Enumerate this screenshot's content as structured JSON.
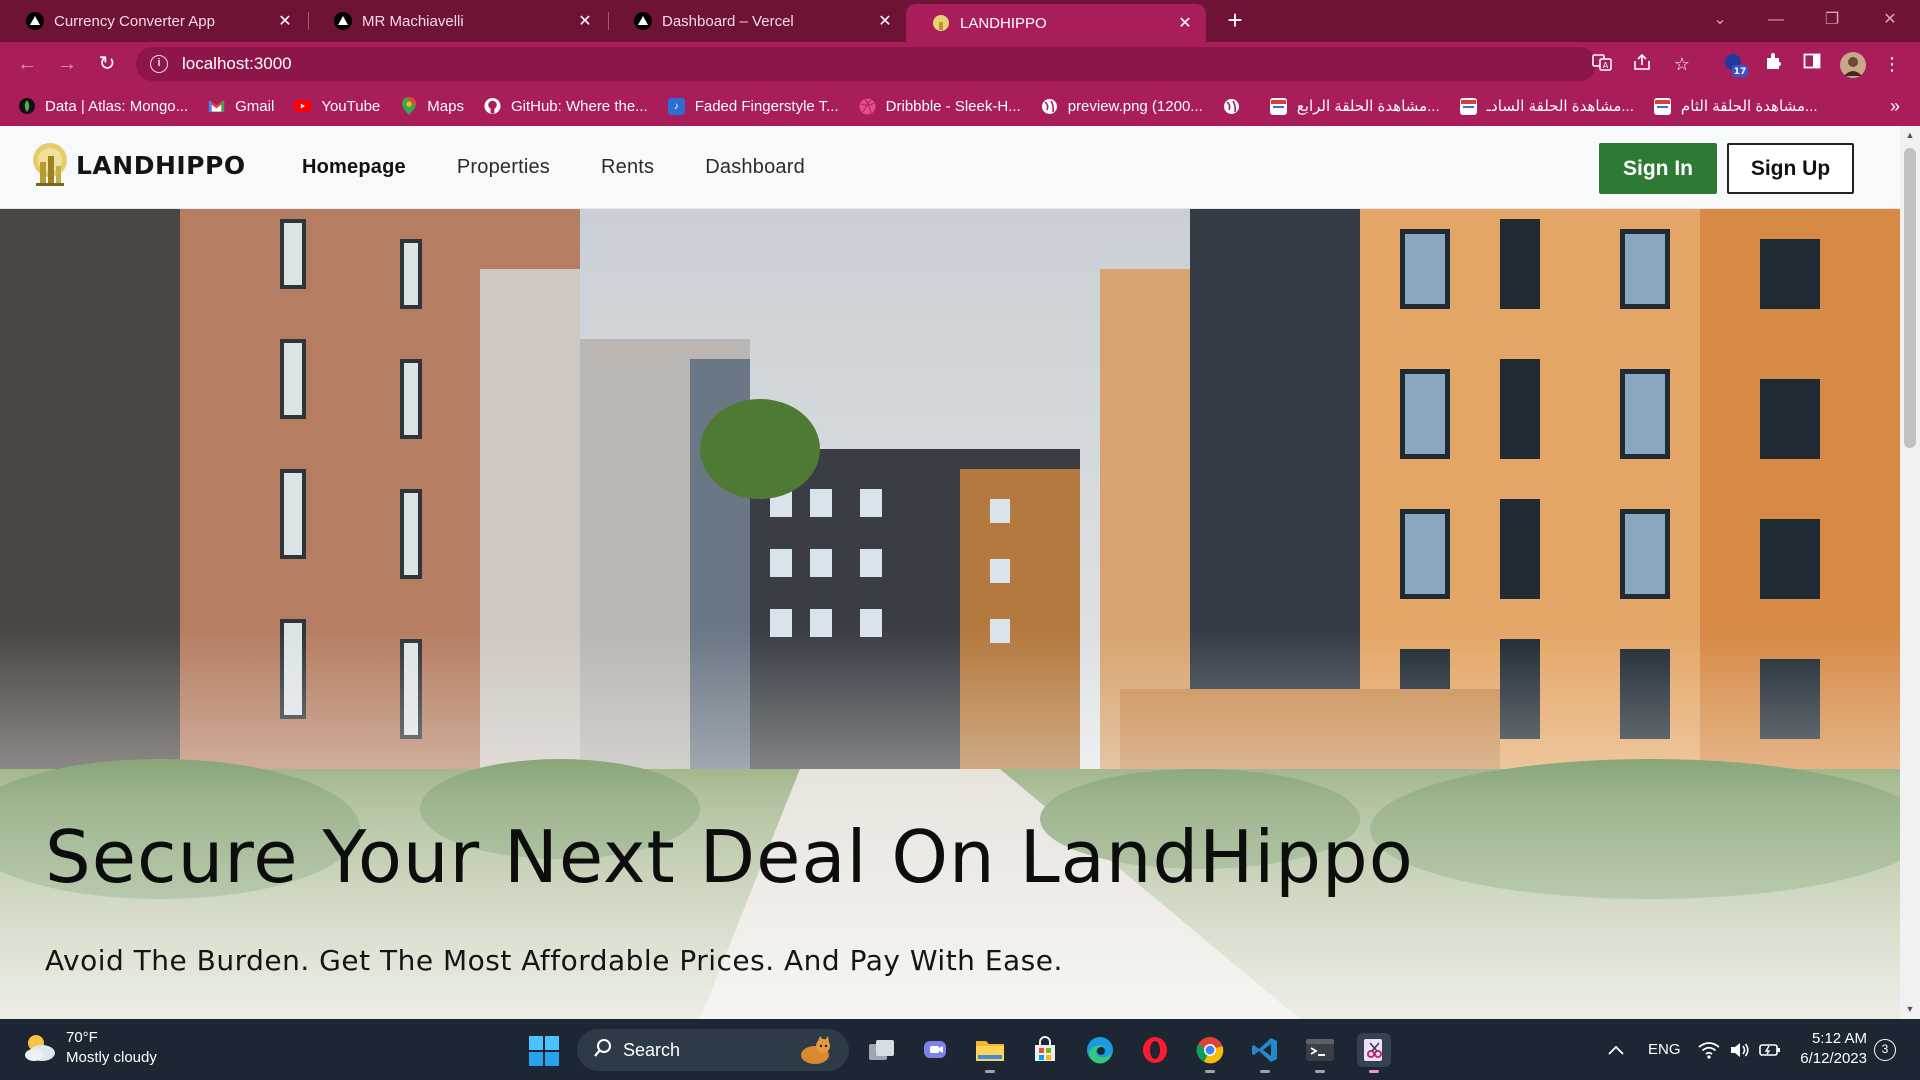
{
  "browser": {
    "tabs": [
      {
        "title": "Currency Converter App",
        "icon": "vercel-triangle-icon",
        "active": false
      },
      {
        "title": "MR Machiavelli",
        "icon": "vercel-triangle-icon",
        "active": false
      },
      {
        "title": "Dashboard – Vercel",
        "icon": "vercel-triangle-icon",
        "active": false
      },
      {
        "title": "LANDHIPPO",
        "icon": "landhippo-favicon",
        "active": true
      }
    ],
    "new_tab": "+",
    "address": "localhost:3000",
    "bookmarks": [
      {
        "label": "Data | Atlas: Mongo...",
        "icon": "mongodb-leaf-icon"
      },
      {
        "label": "Gmail",
        "icon": "gmail-icon"
      },
      {
        "label": "YouTube",
        "icon": "youtube-icon"
      },
      {
        "label": "Maps",
        "icon": "maps-pin-icon"
      },
      {
        "label": "GitHub: Where the...",
        "icon": "github-icon"
      },
      {
        "label": "Faded Fingerstyle T...",
        "icon": "bookmark-site-icon"
      },
      {
        "label": "Dribbble - Sleek-H...",
        "icon": "dribbble-icon"
      },
      {
        "label": "preview.png (1200...",
        "icon": "globe-icon"
      },
      {
        "label": "",
        "icon": "globe-icon"
      },
      {
        "label": "مشاهدة الحلقة الرابع...",
        "icon": "site-thumb-icon"
      },
      {
        "label": "مشاهدة الحلقة السادـ...",
        "icon": "site-thumb-icon"
      },
      {
        "label": "مشاهدة الحلقة الثام...",
        "icon": "site-thumb-icon"
      }
    ],
    "extension_badge": "17",
    "colors": {
      "frame": "#6e1236",
      "toolbar": "#a81d5a"
    }
  },
  "site": {
    "logo_text": "LANDHIPPO",
    "nav": [
      "Homepage",
      "Properties",
      "Rents",
      "Dashboard"
    ],
    "active_nav": "Homepage",
    "sign_in": "Sign In",
    "sign_up": "Sign Up",
    "hero_title": "Secure Your Next Deal On LandHippo",
    "hero_subtitle": "Avoid The Burden. Get The Most Affordable Prices. And Pay With Ease.",
    "colors": {
      "sign_in_bg": "#2e7a35",
      "logo_accent": "#d8c04a"
    }
  },
  "taskbar": {
    "weather_temp": "70°F",
    "weather_desc": "Mostly cloudy",
    "search_label": "Search",
    "language": "ENG",
    "time": "5:12 AM",
    "date": "6/12/2023",
    "notifications": "3"
  }
}
